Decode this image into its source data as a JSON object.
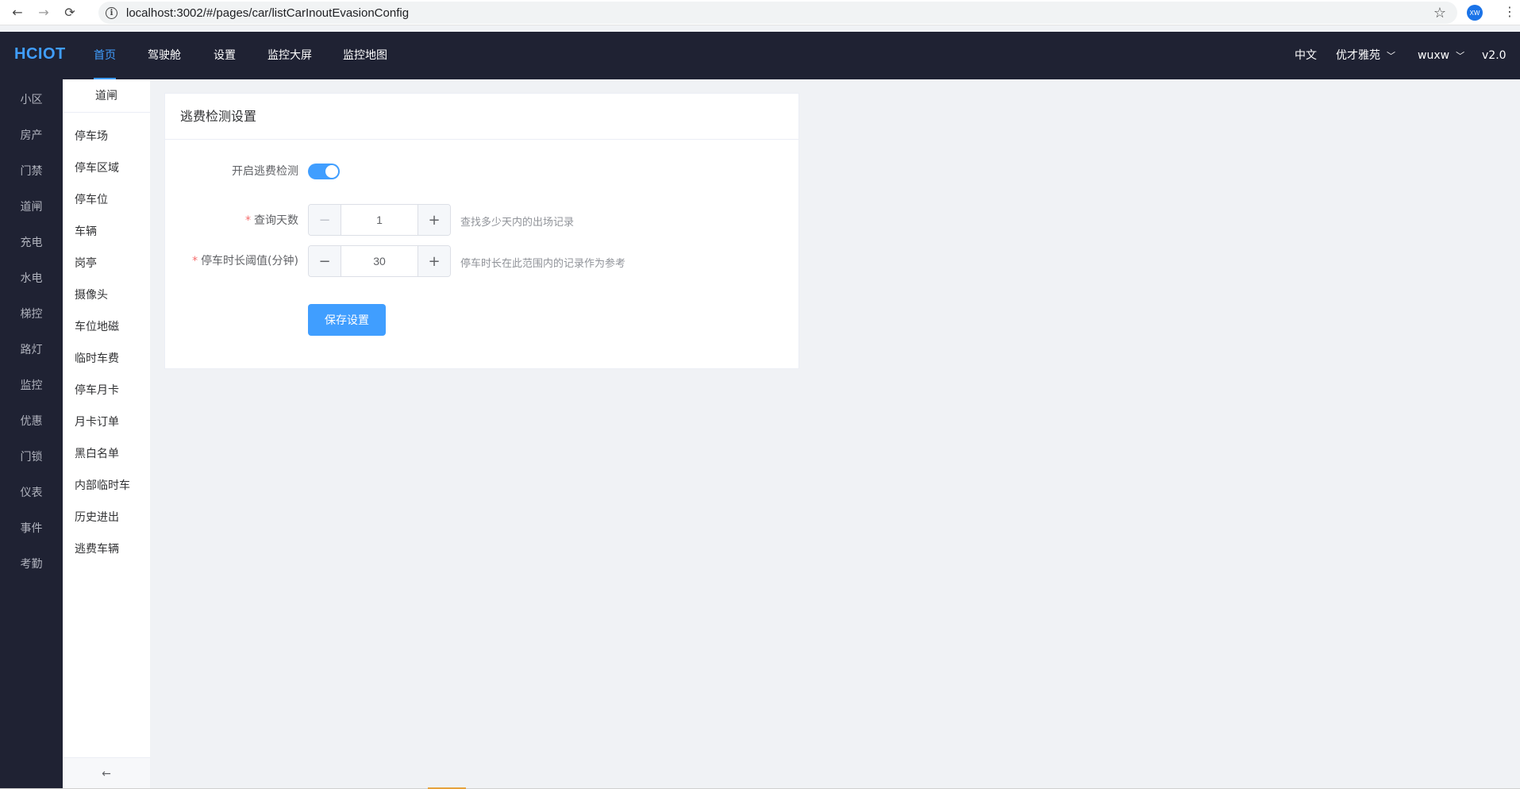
{
  "browser": {
    "url": "localhost:3002/#/pages/car/listCarInoutEvasionConfig",
    "avatar": "XW",
    "back_icon": "←",
    "forward_icon": "→",
    "reload_icon": "⟳",
    "star_icon": "☆",
    "menu_icon": "⋮"
  },
  "topnav": {
    "logo": "HCIOT",
    "items": [
      {
        "label": "首页",
        "active": true
      },
      {
        "label": "驾驶舱"
      },
      {
        "label": "设置"
      },
      {
        "label": "监控大屏"
      },
      {
        "label": "监控地图"
      }
    ],
    "lang": "中文",
    "community": "优才雅苑",
    "user": "wuxw",
    "version": "v2.0"
  },
  "sidebar": {
    "items": [
      "小区",
      "房产",
      "门禁",
      "道闸",
      "充电",
      "水电",
      "梯控",
      "路灯",
      "监控",
      "优惠",
      "门锁",
      "仪表",
      "事件",
      "考勤"
    ]
  },
  "submenu": {
    "title": "道闸",
    "items": [
      "停车场",
      "停车区域",
      "停车位",
      "车辆",
      "岗亭",
      "摄像头",
      "车位地磁",
      "临时车费",
      "停车月卡",
      "月卡订单",
      "黑白名单",
      "内部临时车",
      "历史进出",
      "逃费车辆"
    ],
    "collapse_icon": "←"
  },
  "card": {
    "title": "逃费检测设置",
    "switch_label": "开启逃费检测",
    "switch_on": true,
    "query_days_label": "查询天数",
    "query_days_value": "1",
    "query_days_hint": "查找多少天内的出场记录",
    "threshold_label": "停车时长阈值(分钟)",
    "threshold_value": "30",
    "threshold_hint": "停车时长在此范围内的记录作为参考",
    "required_mark": "*",
    "minus": "−",
    "plus": "+",
    "save_label": "保存设置"
  }
}
